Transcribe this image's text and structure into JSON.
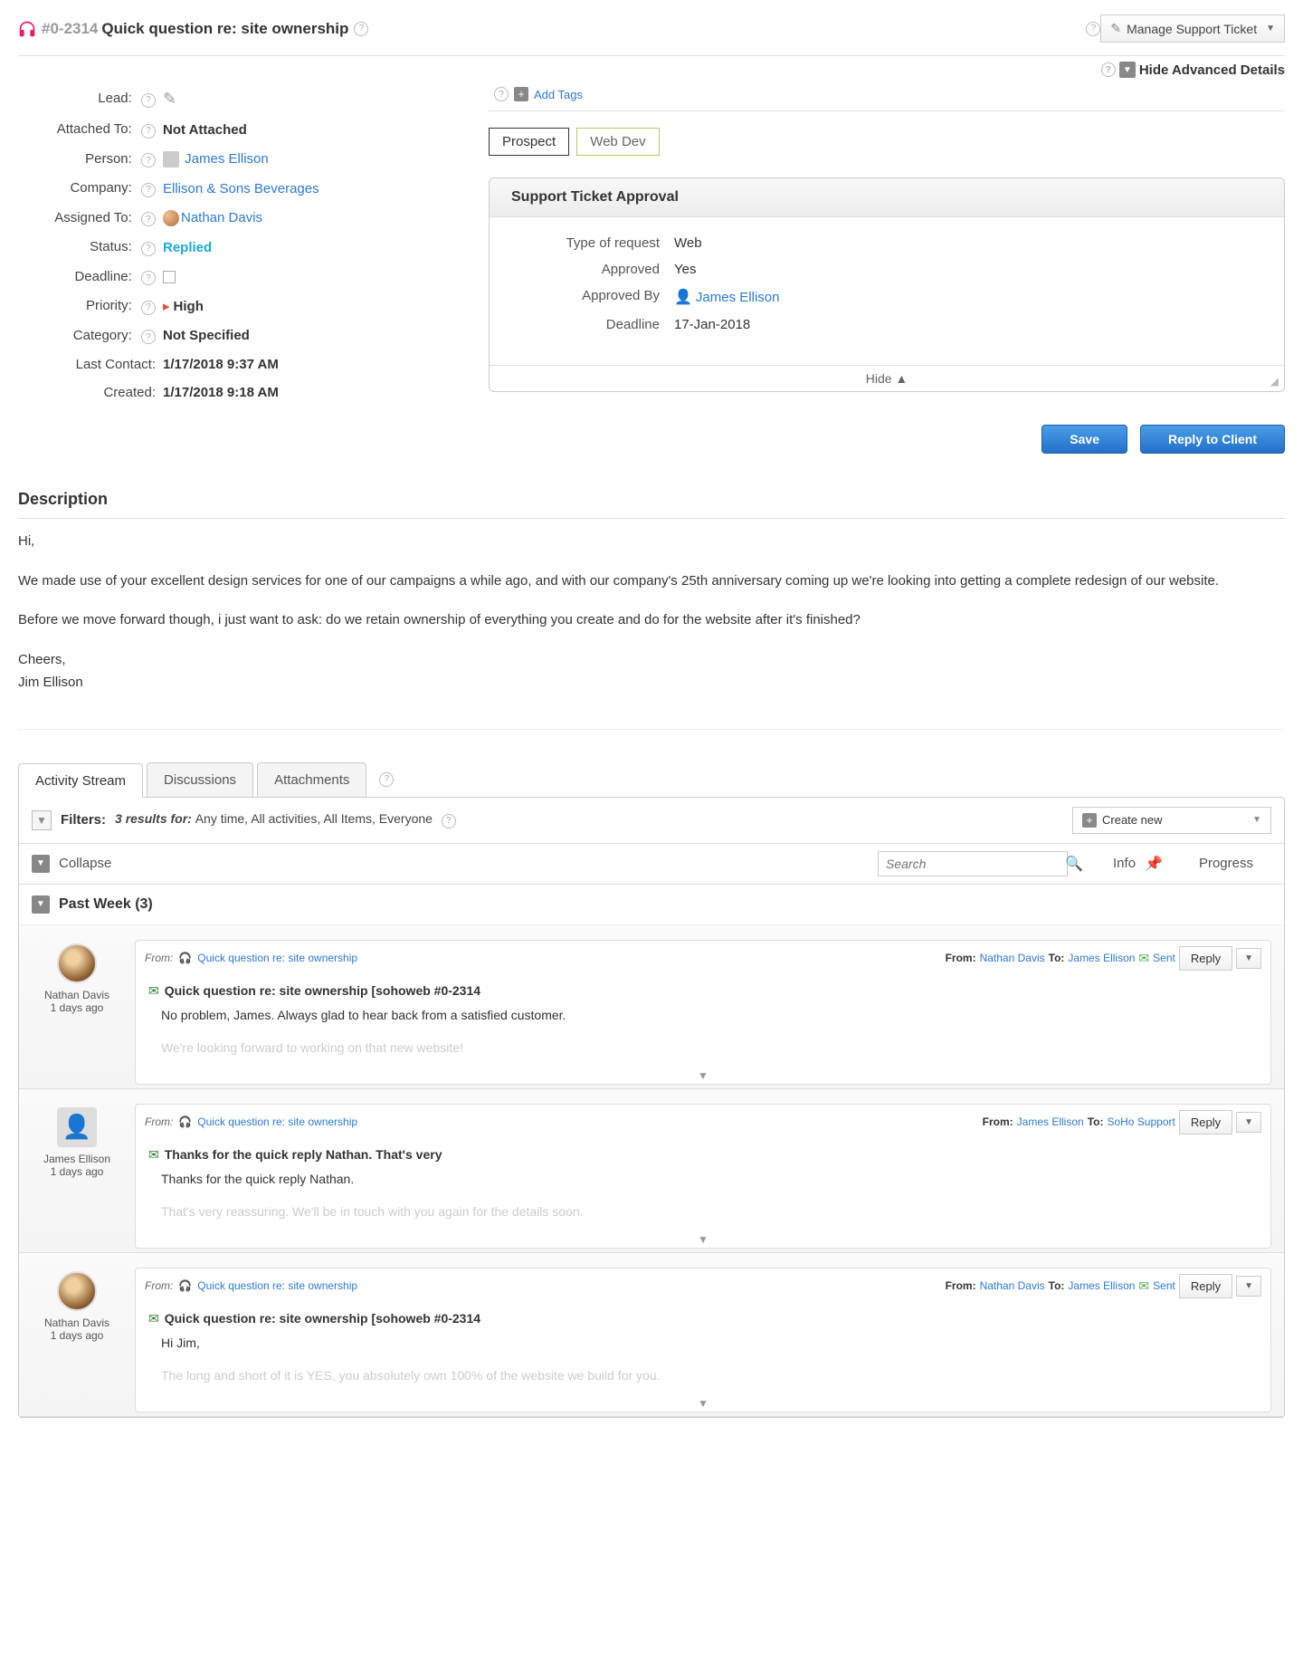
{
  "header": {
    "ticket_id": "#0-2314",
    "title": "Quick question re: site ownership",
    "manage_label": "Manage Support Ticket",
    "hide_advanced": "Hide Advanced Details"
  },
  "fields": {
    "lead_label": "Lead:",
    "attached_label": "Attached To:",
    "attached_value": "Not Attached",
    "person_label": "Person:",
    "person_value": "James Ellison",
    "company_label": "Company:",
    "company_value": "Ellison & Sons Beverages",
    "assigned_label": "Assigned To:",
    "assigned_value": "Nathan Davis",
    "status_label": "Status:",
    "status_value": "Replied",
    "deadline_label": "Deadline:",
    "priority_label": "Priority:",
    "priority_value": "High",
    "category_label": "Category:",
    "category_value": "Not Specified",
    "last_contact_label": "Last Contact:",
    "last_contact_value": "1/17/2018 9:37 AM",
    "created_label": "Created:",
    "created_value": "1/17/2018 9:18 AM"
  },
  "tags": {
    "add_label": "Add Tags",
    "tag1": "Prospect",
    "tag2": "Web Dev"
  },
  "approval": {
    "title": "Support Ticket Approval",
    "type_label": "Type of request",
    "type_value": "Web",
    "approved_label": "Approved",
    "approved_value": "Yes",
    "by_label": "Approved By",
    "by_value": "James Ellison",
    "deadline_label": "Deadline",
    "deadline_value": "17-Jan-2018",
    "hide_label": "Hide ▲"
  },
  "buttons": {
    "save": "Save",
    "reply_client": "Reply to Client"
  },
  "description": {
    "title": "Description",
    "p1": "Hi,",
    "p2": "We made use of your excellent design services for one of our campaigns a while ago, and with our company's 25th anniversary coming up we're looking into getting a complete redesign of our website.",
    "p3": "Before we move forward though, i just want to ask: do we retain ownership of everything you create and do for the website after it's finished?",
    "p4": "Cheers,",
    "p5": "Jim Ellison"
  },
  "tabs": {
    "activity": "Activity Stream",
    "discussions": "Discussions",
    "attachments": "Attachments"
  },
  "filters": {
    "label": "Filters:",
    "results": "3 results for: ",
    "criteria": "Any time, All activities, All Items, Everyone",
    "create_new": "Create new",
    "collapse": "Collapse",
    "search_placeholder": "Search",
    "info": "Info",
    "progress": "Progress",
    "group_label": "Past Week (3)"
  },
  "activities": [
    {
      "author": "Nathan Davis",
      "ago": "1 days ago",
      "source": "Quick question re: site ownership",
      "from_label": "From:",
      "from_person": "Nathan Davis",
      "to_label": "To:",
      "to_person": "James Ellison",
      "status": "Sent",
      "reply": "Reply",
      "subject": "Quick question re: site ownership [sohoweb #0-2314",
      "snippet": "No problem, James. Always glad to hear back from a satisfied customer.",
      "fade": "We're looking forward to working on that new website!"
    },
    {
      "author": "James Ellison",
      "ago": "1 days ago",
      "source": "Quick question re: site ownership",
      "from_label": "From:",
      "from_person": "James Ellison",
      "to_label": "To:",
      "to_person": "SoHo Support",
      "reply": "Reply",
      "subject": "Thanks for the quick reply Nathan. That's very",
      "snippet": "Thanks for the quick reply Nathan.",
      "fade": "That's very reassuring. We'll be in touch with you again for the details soon."
    },
    {
      "author": "Nathan Davis",
      "ago": "1 days ago",
      "source": "Quick question re: site ownership",
      "from_label": "From:",
      "from_person": "Nathan Davis",
      "to_label": "To:",
      "to_person": "James Ellison",
      "status": "Sent",
      "reply": "Reply",
      "subject": "Quick question re: site ownership [sohoweb #0-2314",
      "snippet": "Hi Jim,",
      "fade": "The long and short of it is YES, you absolutely own 100% of the website we build for you."
    }
  ]
}
